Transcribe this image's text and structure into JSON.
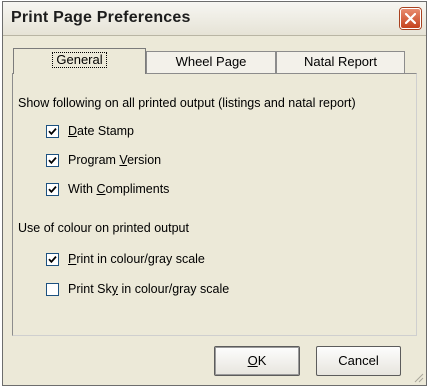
{
  "window": {
    "title": "Print Page Preferences"
  },
  "tabs": [
    {
      "label": "General",
      "active": true
    },
    {
      "label": "Wheel Page",
      "active": false
    },
    {
      "label": "Natal Report",
      "active": false
    }
  ],
  "general": {
    "section1_title": "Show following on all printed output (listings and natal report)",
    "options1": [
      {
        "label": "Date Stamp",
        "mnemonic": "D",
        "checked": true
      },
      {
        "label": "Program Version",
        "mnemonic": "V",
        "checked": true
      },
      {
        "label": "With Compliments",
        "mnemonic": "C",
        "checked": true
      }
    ],
    "section2_title": "Use of colour on printed output",
    "options2": [
      {
        "label": "Print in colour/gray scale",
        "mnemonic": "P",
        "checked": true
      },
      {
        "label": "Print Sky in colour/gray scale",
        "mnemonic": "y",
        "checked": false
      }
    ]
  },
  "buttons": {
    "ok": "OK",
    "cancel": "Cancel"
  },
  "colors": {
    "dialog_bg": "#ece9d8",
    "close_button": "#c5421e",
    "checkbox_border": "#1c5180"
  },
  "icons": {
    "close": "close-icon",
    "check": "checkmark-icon"
  }
}
